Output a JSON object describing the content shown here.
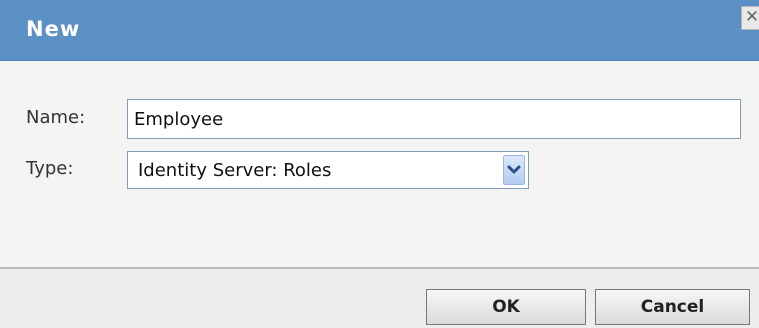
{
  "dialog": {
    "title": "New",
    "close_icon": "close-icon",
    "close_glyph": "✕"
  },
  "form": {
    "name_label": "Name:",
    "name_value": "Employee",
    "type_label": "Type:",
    "type_value": "Identity Server: Roles",
    "type_dropdown_icon": "chevron-down-icon"
  },
  "buttons": {
    "ok_label": "OK",
    "cancel_label": "Cancel"
  },
  "colors": {
    "titlebar": "#5b90c4",
    "title_text": "#ffffff",
    "background": "#f4f4f4",
    "input_border": "#7f9db9"
  }
}
